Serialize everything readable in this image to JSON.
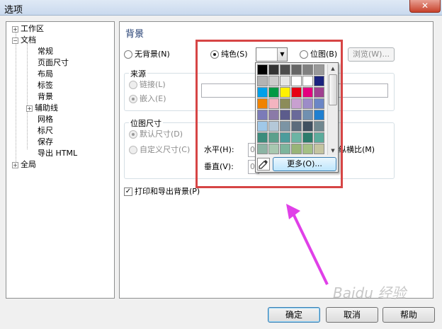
{
  "window": {
    "title": "选项",
    "close_glyph": "✕"
  },
  "tree": {
    "items": [
      {
        "label": "工作区",
        "expander": "+"
      },
      {
        "label": "文档",
        "expander": "−"
      },
      {
        "label": "常规"
      },
      {
        "label": "页面尺寸"
      },
      {
        "label": "布局"
      },
      {
        "label": "标签"
      },
      {
        "label": "背景"
      },
      {
        "label": "辅助线",
        "expander": "+"
      },
      {
        "label": "网格"
      },
      {
        "label": "标尺"
      },
      {
        "label": "保存"
      },
      {
        "label": "导出 HTML"
      },
      {
        "label": "全局",
        "expander": "+"
      }
    ]
  },
  "panel": {
    "heading": "背景",
    "bg_options": {
      "none": "无背景(N)",
      "solid": "纯色(S)",
      "bitmap": "位图(B)",
      "browse": "浏览(W)..."
    },
    "source": {
      "title": "来源",
      "link": "链接(L)",
      "embed": "嵌入(E)"
    },
    "bitmap_size": {
      "title": "位图尺寸",
      "default": "默认尺寸(D)",
      "custom": "自定义尺寸(C)",
      "horizontal": "水平(H):",
      "vertical": "垂直(V):",
      "aspect": "纵横比(M)",
      "value_prefix": "0"
    },
    "print_export": "打印和导出背景(P)",
    "print_checked": "✓"
  },
  "palette": {
    "more": "更多(O)...",
    "colors": [
      "#000000",
      "#333333",
      "#4d4d4d",
      "#666666",
      "#808080",
      "#999999",
      "#b3b3b3",
      "#cccccc",
      "#e6e6e6",
      "#ffffff",
      "#ffffff",
      "#1a237e",
      "#00a0e9",
      "#009944",
      "#fff100",
      "#e60012",
      "#e4007f",
      "#a04090",
      "#f08300",
      "#f4b4c0",
      "#8c8c5a",
      "#c8a0d0",
      "#9c8cc8",
      "#6b86c6",
      "#7b7bb8",
      "#8b7aa8",
      "#5c5c8c",
      "#6a6a9a",
      "#7090b0",
      "#2080d0",
      "#a0c8e8",
      "#b4c8d8",
      "#7c94a4",
      "#5c6c7c",
      "#405060",
      "#708890",
      "#3c8c7c",
      "#5ca08c",
      "#4c9c9c",
      "#6cb4a4",
      "#2c7c6c",
      "#5cac9c",
      "#8cb4a4",
      "#a8c8b0",
      "#7cb49c",
      "#98b478",
      "#a4c084",
      "#c4c4a0"
    ],
    "scroll_up": "▲",
    "scroll_down": "▼"
  },
  "footer": {
    "ok": "确定",
    "cancel": "取消",
    "help": "帮助"
  },
  "watermark": "Baidu 经验",
  "colors": {
    "highlight": "#d64545",
    "arrow": "#e040e8"
  }
}
